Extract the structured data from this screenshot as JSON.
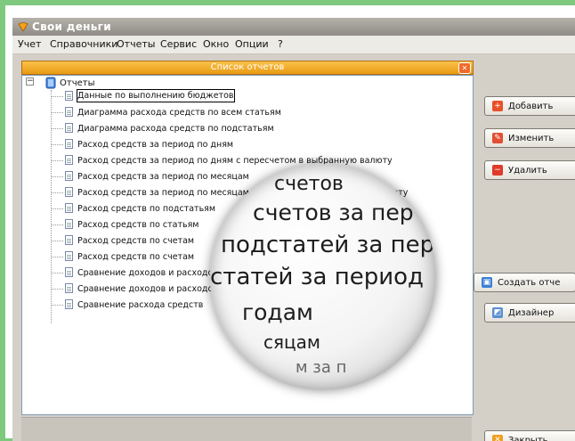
{
  "window": {
    "title": "Свои деньги"
  },
  "menu": [
    "Учет",
    "Справочники",
    "Отчеты",
    "Сервис",
    "Окно",
    "Опции",
    "?"
  ],
  "subwindow": {
    "title": "Список отчетов"
  },
  "tree": {
    "root": "Отчеты",
    "items": [
      "Данные по выполнению бюджетов",
      "Диаграмма расхода средств по всем статьям",
      "Диаграмма расхода средств по подстатьям",
      "Расход средств за период по дням",
      "Расход средств за период по дням с пересчетом в выбранную валюту",
      "Расход средств за период по месяцам",
      "Расход средств за период по месяцам с пересчетом в выбранную валюту",
      "Расход средств по подстатьям",
      "Расход средств по статьям",
      "Расход средств по счетам",
      "Расход средств по счетам",
      "Сравнение доходов и расходов",
      "Сравнение доходов и расходов",
      "Сравнение расхода средств"
    ]
  },
  "buttons": {
    "add": "Добавить",
    "edit": "Изменить",
    "delete": "Удалить",
    "create_report": "Создать отче",
    "designer": "Дизайнер",
    "close": "Закрыть"
  },
  "magnifier_lines": [
    "счетов",
    "счетов за пер",
    "подстатей за пер",
    "статей за период",
    "годам",
    "сяцам",
    "м за п"
  ],
  "colors": {
    "accent": "#f0a020",
    "frame": "#7fc97f"
  }
}
